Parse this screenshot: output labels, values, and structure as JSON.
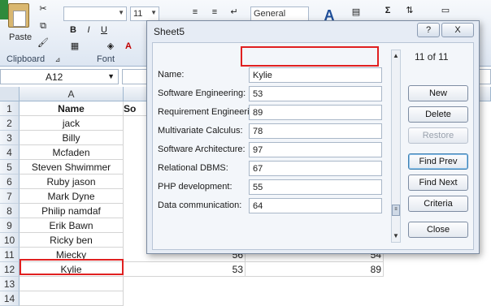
{
  "ribbon": {
    "paste_label": "Paste",
    "clipboard_label": "Clipboard",
    "font_label": "Font",
    "font_size": "11",
    "number_format": "General",
    "bold": "B",
    "italic": "I",
    "underline": "U",
    "font_color": "A",
    "sum_symbol": "Σ"
  },
  "formula_bar": {
    "name_box": "A12"
  },
  "sheet": {
    "column_headers": [
      "A"
    ],
    "rows": [
      {
        "num": "1",
        "a": "Name",
        "b": "So"
      },
      {
        "num": "2",
        "a": "jack"
      },
      {
        "num": "3",
        "a": "Billy"
      },
      {
        "num": "4",
        "a": "Mcfaden"
      },
      {
        "num": "5",
        "a": "Steven Shwimmer"
      },
      {
        "num": "6",
        "a": "Ruby jason"
      },
      {
        "num": "7",
        "a": "Mark Dyne"
      },
      {
        "num": "8",
        "a": "Philip namdaf"
      },
      {
        "num": "9",
        "a": "Erik Bawn"
      },
      {
        "num": "10",
        "a": "Ricky ben"
      },
      {
        "num": "11",
        "a": "Miecky",
        "bv": "56",
        "cv": "54"
      },
      {
        "num": "12",
        "a": "Kylie",
        "bv": "53",
        "cv": "89"
      },
      {
        "num": "13",
        "a": ""
      },
      {
        "num": "14",
        "a": ""
      }
    ]
  },
  "dialog": {
    "title": "Sheet5",
    "help_button": "?",
    "close_button": "X",
    "record_counter": "11 of 11",
    "fields": [
      {
        "label": "Name:",
        "value": "Kylie"
      },
      {
        "label": "Software Engineering:",
        "value": "53"
      },
      {
        "label": "Requirement Engineering:",
        "value": "89"
      },
      {
        "label": "Multivariate Calculus:",
        "value": "78"
      },
      {
        "label": "Software Architecture:",
        "value": "97"
      },
      {
        "label": "Relational DBMS:",
        "value": "67"
      },
      {
        "label": "PHP development:",
        "value": "55"
      },
      {
        "label": "Data communication:",
        "value": "64"
      }
    ],
    "buttons": {
      "new": "New",
      "delete": "Delete",
      "restore": "Restore",
      "find_prev": "Find Prev",
      "find_next": "Find Next",
      "criteria": "Criteria",
      "close": "Close"
    }
  }
}
